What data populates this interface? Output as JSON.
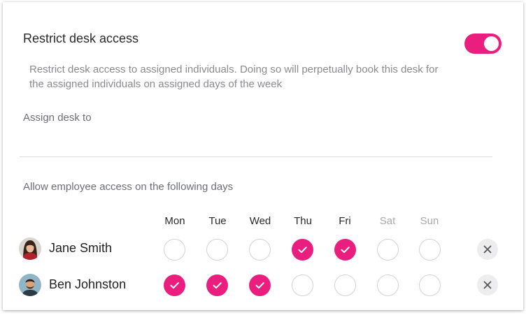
{
  "restrict": {
    "title": "Restrict desk access",
    "description": "Restrict desk access to assigned individuals. Doing so will perpetually book this desk for the assigned individuals on assigned days of the week",
    "enabled": true
  },
  "assign": {
    "label": "Assign desk to"
  },
  "access": {
    "label": "Allow employee access on the following days"
  },
  "days": [
    "Mon",
    "Tue",
    "Wed",
    "Thu",
    "Fri",
    "Sat",
    "Sun"
  ],
  "people": [
    {
      "name": "Jane Smith",
      "checked": [
        false,
        false,
        false,
        true,
        true,
        false,
        false
      ]
    },
    {
      "name": "Ben Johnston",
      "checked": [
        true,
        true,
        true,
        false,
        false,
        false,
        false
      ]
    }
  ],
  "colors": {
    "accent": "#ea1e7f",
    "unchecked_border": "#d2d2d6",
    "remove_bg": "#ededef"
  },
  "icons": {
    "check": "check-icon",
    "remove": "close-icon"
  }
}
